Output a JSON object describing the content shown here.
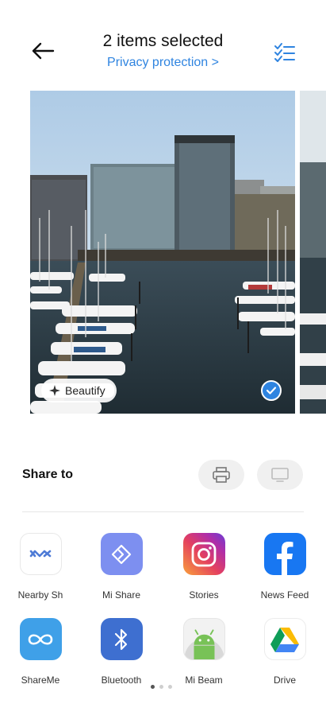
{
  "header": {
    "title": "2 items selected",
    "privacy_link": "Privacy protection >",
    "back_icon": "arrow-left-icon",
    "select_icon": "checklist-icon"
  },
  "photo": {
    "beautify_label": "Beautify",
    "selected": true
  },
  "share": {
    "label": "Share to",
    "actions": [
      {
        "icon": "printer-icon"
      },
      {
        "icon": "monitor-icon"
      }
    ]
  },
  "apps": [
    {
      "label": "Nearby Sh",
      "icon": "nearby-share-icon"
    },
    {
      "label": "Mi Share",
      "icon": "mi-share-icon"
    },
    {
      "label": "Stories",
      "icon": "instagram-icon"
    },
    {
      "label": "News Feed",
      "icon": "facebook-icon"
    },
    {
      "label": "ShareMe",
      "icon": "shareme-icon"
    },
    {
      "label": "Bluetooth",
      "icon": "bluetooth-icon"
    },
    {
      "label": "Mi Beam",
      "icon": "android-icon"
    },
    {
      "label": "Drive",
      "icon": "google-drive-icon"
    }
  ],
  "pager": {
    "pages": 3,
    "active": 1
  },
  "colors": {
    "accent": "#2f84e0"
  }
}
